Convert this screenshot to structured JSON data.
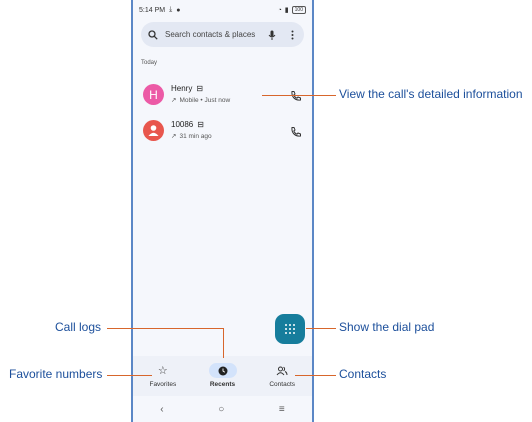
{
  "status": {
    "time": "5:14",
    "ampm": "PM",
    "battery": "100"
  },
  "search": {
    "placeholder": "Search contacts & places"
  },
  "section_label": "Today",
  "calls": [
    {
      "initial": "H",
      "name": "Henry",
      "detail": "Mobile • Just now",
      "avatar_color": "#ec5aa6"
    },
    {
      "initial": "",
      "name": "10086",
      "detail": "31 min ago",
      "avatar_color": "#e8564d"
    }
  ],
  "nav": [
    {
      "label": "Favorites",
      "icon": "star-icon"
    },
    {
      "label": "Recents",
      "icon": "clock-icon"
    },
    {
      "label": "Contacts",
      "icon": "people-icon"
    }
  ],
  "callouts": {
    "details": "View the call's detailed information",
    "dialpad": "Show the dial pad",
    "call_logs": "Call logs",
    "favorites": "Favorite numbers",
    "contacts": "Contacts"
  },
  "colors": {
    "accent": "#167d9c",
    "annotation": "#1c4f9b",
    "leader": "#d7662c"
  }
}
